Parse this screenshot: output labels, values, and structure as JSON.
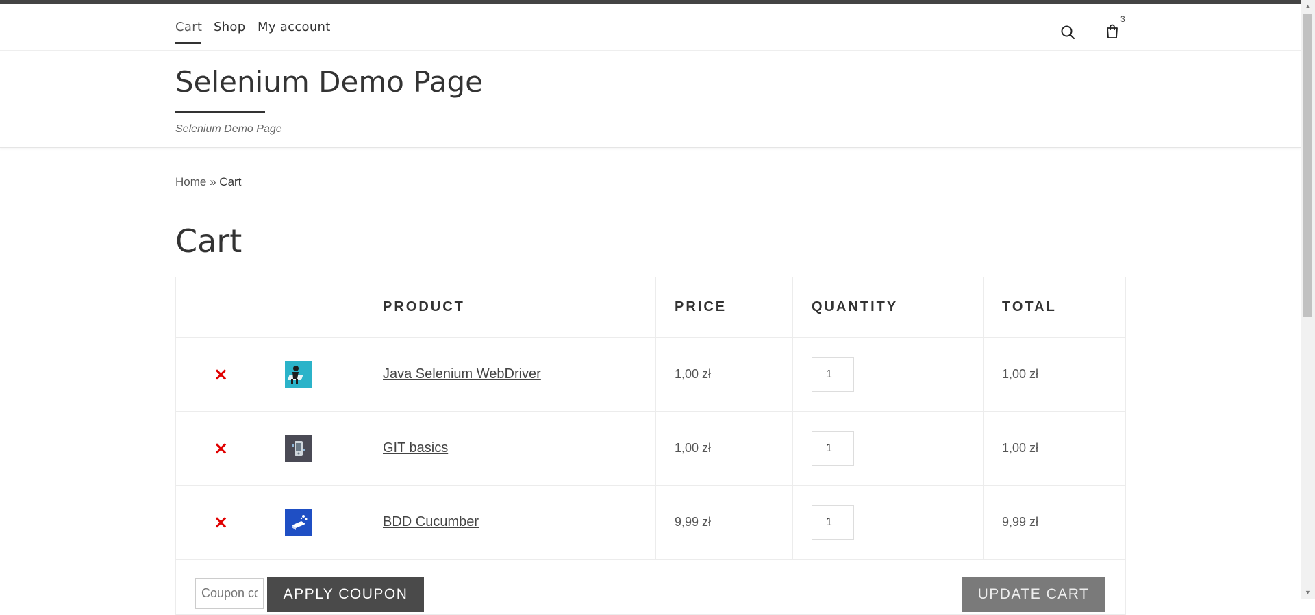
{
  "nav": {
    "items": [
      {
        "label": "Cart"
      },
      {
        "label": "Shop"
      },
      {
        "label": "My account"
      }
    ],
    "cart_count": "3"
  },
  "site": {
    "title": "Selenium Demo Page",
    "tagline": "Selenium Demo Page"
  },
  "breadcrumb": {
    "home": "Home",
    "separator": "»",
    "current": "Cart"
  },
  "page_title": "Cart",
  "table": {
    "headers": [
      "",
      "",
      "PRODUCT",
      "PRICE",
      "QUANTITY",
      "TOTAL"
    ],
    "rows": [
      {
        "remove": "×",
        "thumb_icon": "selenium-thumb",
        "product": "Java Selenium WebDriver",
        "price": "1,00 zł",
        "quantity": "1",
        "total": "1,00 zł"
      },
      {
        "remove": "×",
        "thumb_icon": "git-thumb",
        "product": "GIT basics",
        "price": "1,00 zł",
        "quantity": "1",
        "total": "1,00 zł"
      },
      {
        "remove": "×",
        "thumb_icon": "bdd-thumb",
        "product": "BDD Cucumber",
        "price": "9,99 zł",
        "quantity": "1",
        "total": "9,99 zł"
      }
    ]
  },
  "actions": {
    "coupon_placeholder": "Coupon code",
    "apply_label": "APPLY COUPON",
    "update_label": "UPDATE CART"
  },
  "colors": {
    "remove": "#e00000",
    "apply_button": "#4a4a4a",
    "update_button": "#7a7a7a"
  }
}
